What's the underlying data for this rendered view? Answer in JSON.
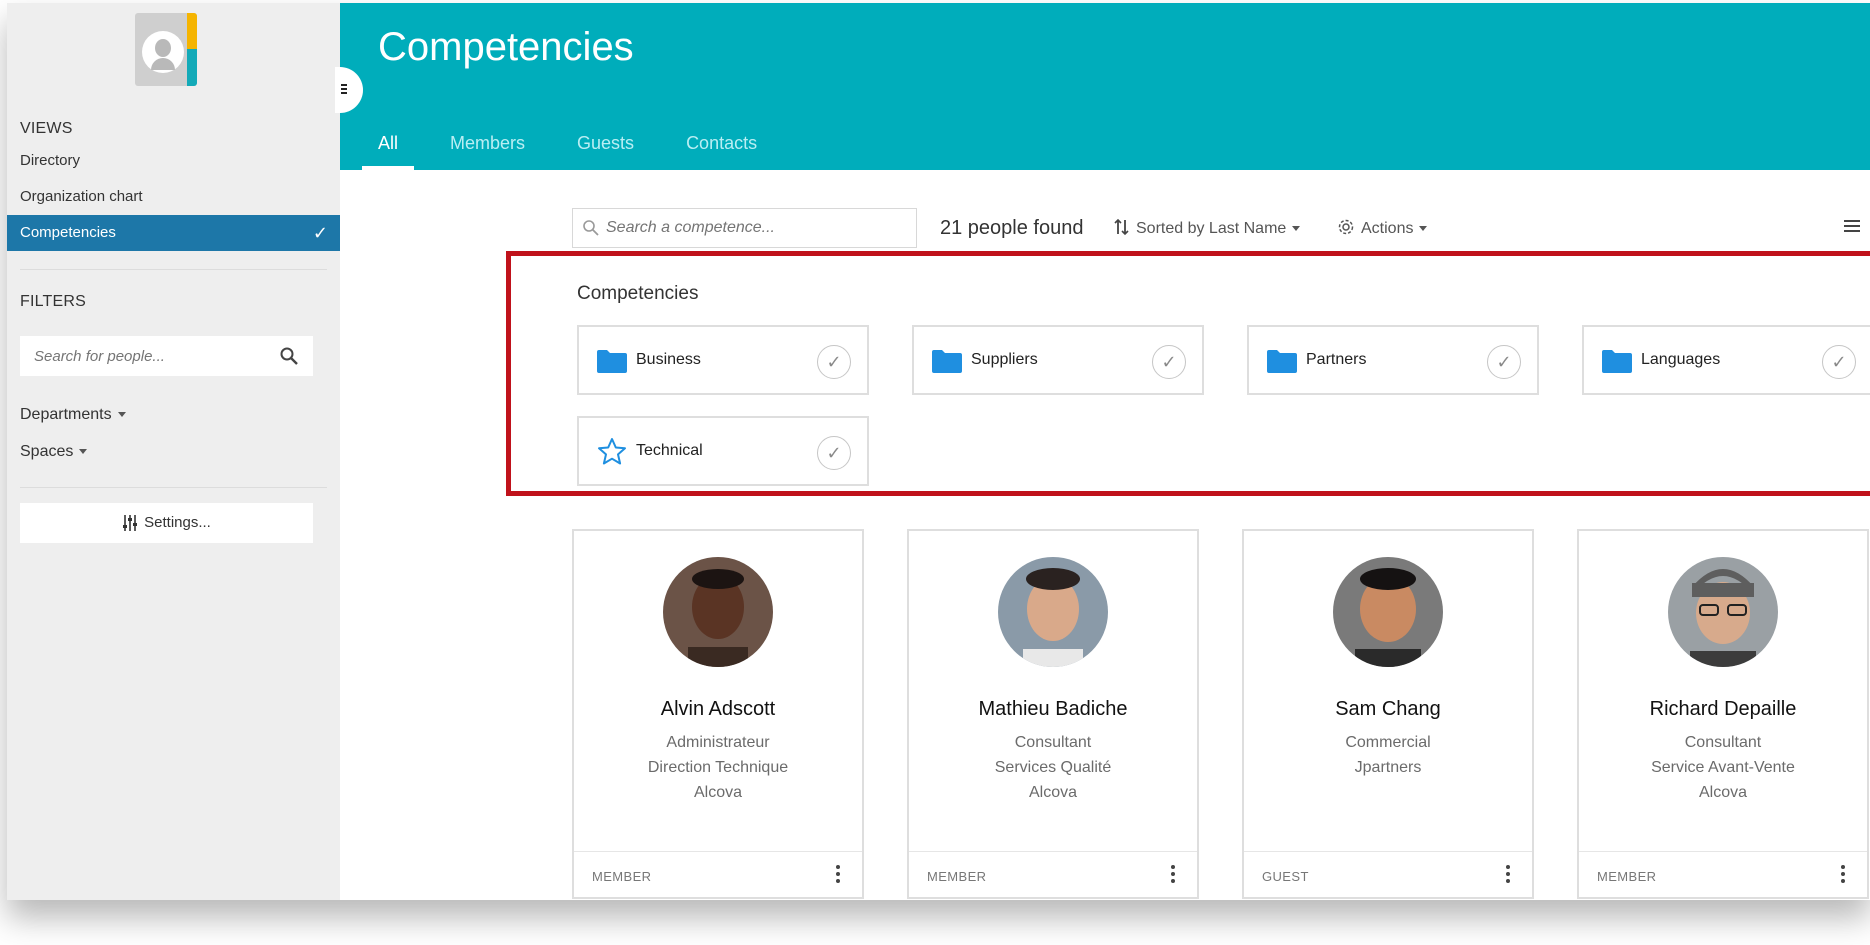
{
  "sidebar": {
    "views_title": "VIEWS",
    "views": [
      {
        "label": "Directory"
      },
      {
        "label": "Organization chart"
      },
      {
        "label": "Competencies",
        "active": true
      }
    ],
    "filters_title": "FILTERS",
    "people_search": {
      "placeholder": "Search for people..."
    },
    "departments_label": "Departments",
    "spaces_label": "Spaces",
    "settings_label": "Settings..."
  },
  "header": {
    "title": "Competencies",
    "tabs": [
      {
        "label": "All",
        "active": true
      },
      {
        "label": "Members"
      },
      {
        "label": "Guests"
      },
      {
        "label": "Contacts"
      }
    ]
  },
  "toolbar": {
    "search_placeholder": "Search a competence...",
    "found_text": "21 people found",
    "sort_label": "Sorted by Last Name",
    "actions_label": "Actions"
  },
  "competencies": {
    "heading": "Competencies",
    "items": [
      {
        "label": "Business",
        "icon": "folder-icon"
      },
      {
        "label": "Suppliers",
        "icon": "folder-icon"
      },
      {
        "label": "Partners",
        "icon": "folder-icon"
      },
      {
        "label": "Languages",
        "icon": "folder-icon"
      },
      {
        "label": "Technical",
        "icon": "star-icon"
      }
    ]
  },
  "people": [
    {
      "name": "Alvin Adscott",
      "lines": [
        "Administrateur",
        "Direction Technique",
        "Alcova"
      ],
      "role": "MEMBER"
    },
    {
      "name": "Mathieu Badiche",
      "lines": [
        "Consultant",
        "Services Qualité",
        "Alcova"
      ],
      "role": "MEMBER"
    },
    {
      "name": "Sam Chang",
      "lines": [
        "Commercial",
        "Jpartners"
      ],
      "role": "GUEST"
    },
    {
      "name": "Richard Depaille",
      "lines": [
        "Consultant",
        "Service Avant-Vente",
        "Alcova"
      ],
      "role": "MEMBER"
    }
  ],
  "colors": {
    "header": "#00adbb",
    "active_nav": "#1d77a8",
    "highlight_border": "#c0121b",
    "folder": "#1f8fe0"
  }
}
